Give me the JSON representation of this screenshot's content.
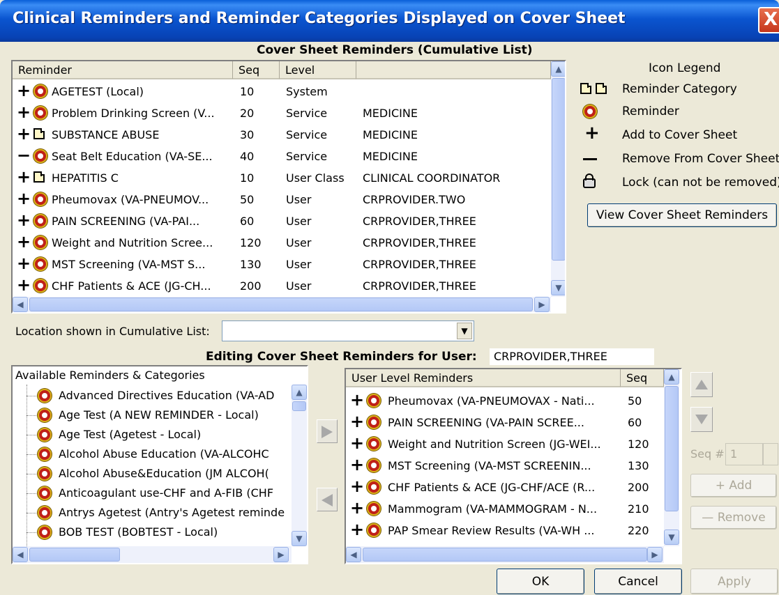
{
  "window": {
    "title": "Clinical Reminders and Reminder Categories Displayed on Cover Sheet",
    "close": "X"
  },
  "cumulative": {
    "heading": "Cover Sheet Reminders (Cumulative List)",
    "columns": [
      "Reminder",
      "Seq",
      "Level",
      ""
    ],
    "rows": [
      {
        "sign": "+",
        "icon": "reminder-clock-icon",
        "name": "AGETEST (Local)",
        "seq": "10",
        "level": "System",
        "value": ""
      },
      {
        "sign": "+",
        "icon": "reminder-clock-icon",
        "name": "Problem Drinking Screen (V...",
        "seq": "20",
        "level": "Service",
        "value": "MEDICINE"
      },
      {
        "sign": "+",
        "icon": "folder-icon",
        "name": "SUBSTANCE ABUSE",
        "seq": "30",
        "level": "Service",
        "value": "MEDICINE"
      },
      {
        "sign": "−",
        "icon": "reminder-clock-icon",
        "name": "Seat Belt Education (VA-SE...",
        "seq": "40",
        "level": "Service",
        "value": "MEDICINE"
      },
      {
        "sign": "+",
        "icon": "folder-icon",
        "name": "HEPATITIS C",
        "seq": "10",
        "level": "User Class",
        "value": "CLINICAL COORDINATOR"
      },
      {
        "sign": "+",
        "icon": "reminder-clock-icon",
        "name": "Pheumovax (VA-PNEUMOV...",
        "seq": "50",
        "level": "User",
        "value": "CRPROVIDER.TWO"
      },
      {
        "sign": "+",
        "icon": "reminder-clock-icon",
        "name": "PAIN SCREENING (VA-PAI...",
        "seq": "60",
        "level": "User",
        "value": "CRPROVIDER,THREE"
      },
      {
        "sign": "+",
        "icon": "reminder-clock-icon",
        "name": "Weight and Nutrition Scree...",
        "seq": "120",
        "level": "User",
        "value": "CRPROVIDER,THREE"
      },
      {
        "sign": "+",
        "icon": "reminder-clock-icon",
        "name": "MST Screening (VA-MST S...",
        "seq": "130",
        "level": "User",
        "value": "CRPROVIDER,THREE"
      },
      {
        "sign": "+",
        "icon": "reminder-clock-icon",
        "name": "CHF Patients & ACE (JG-CH...",
        "seq": "200",
        "level": "User",
        "value": "CRPROVIDER,THREE"
      }
    ]
  },
  "legend": {
    "title": "Icon Legend",
    "items": [
      {
        "icon": "folder-icon",
        "label": "Reminder Category"
      },
      {
        "icon": "reminder-clock-icon",
        "label": "Reminder"
      },
      {
        "icon": "plus-icon",
        "label": "Add to Cover Sheet"
      },
      {
        "icon": "minus-icon",
        "label": "Remove From Cover Sheet"
      },
      {
        "icon": "lock-icon",
        "label": "Lock (can not be removed)"
      }
    ],
    "view_button": "View Cover Sheet Reminders"
  },
  "location": {
    "label": "Location shown in Cumulative List:",
    "value": ""
  },
  "editing": {
    "label": "Editing Cover Sheet Reminders for User:",
    "user": "CRPROVIDER,THREE"
  },
  "available": {
    "header": "Available Reminders & Categories",
    "items": [
      "Advanced Directives Education (VA-AD",
      "Age Test (A NEW REMINDER - Local)",
      "Age Test (Agetest - Local)",
      "Alcohol Abuse Education (VA-ALCOHC",
      "Alcohol Abuse&Education (JM ALCOH(",
      "Anticoagulant use-CHF and A-FIB (CHF",
      "Antrys Agetest (Antry's Agetest reminde",
      "BOB TEST (BOBTEST - Local)"
    ]
  },
  "user_level": {
    "columns": [
      "User Level Reminders",
      "Seq"
    ],
    "rows": [
      {
        "sign": "+",
        "name": "Pheumovax (VA-PNEUMOVAX - Nati...",
        "seq": "50"
      },
      {
        "sign": "+",
        "name": "PAIN SCREENING (VA-PAIN SCREE...",
        "seq": "60"
      },
      {
        "sign": "+",
        "name": "Weight and Nutrition Screen (JG-WEI...",
        "seq": "120"
      },
      {
        "sign": "+",
        "name": "MST Screening (VA-MST SCREENIN...",
        "seq": "130"
      },
      {
        "sign": "+",
        "name": "CHF Patients & ACE (JG-CHF/ACE (R...",
        "seq": "200"
      },
      {
        "sign": "+",
        "name": "Mammogram (VA-MAMMOGRAM - N...",
        "seq": "210"
      },
      {
        "sign": "+",
        "name": "PAP Smear Review Results (VA-WH ...",
        "seq": "220"
      }
    ]
  },
  "side_controls": {
    "seq_label": "Seq #",
    "seq_value": "1",
    "add": "+ Add",
    "remove": "— Remove"
  },
  "footer": {
    "ok": "OK",
    "cancel": "Cancel",
    "apply": "Apply"
  }
}
